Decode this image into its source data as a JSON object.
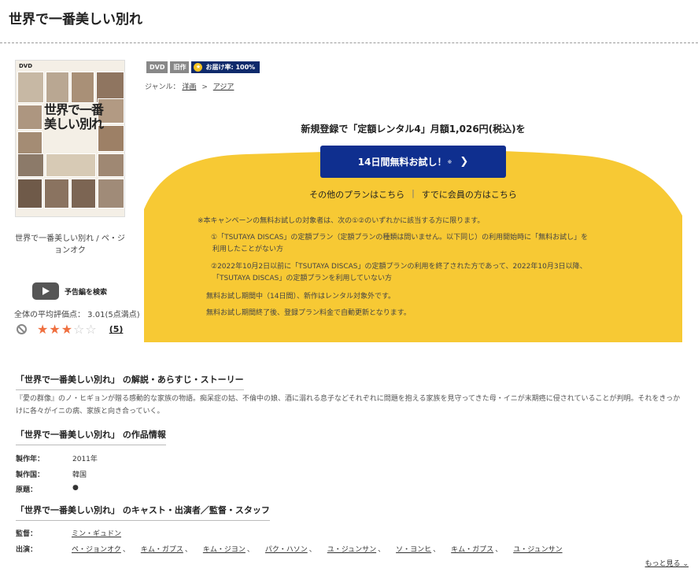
{
  "title": "世界で一番美しい別れ",
  "cover": {
    "dvd_mark": "DVD",
    "title_text": "世界で一番\n美しい別れ"
  },
  "cover_caption": "世界で一番美しい別れ / ペ・ジョンオク",
  "trailer_label": "予告編を検索",
  "average": "全体の平均評価点：  3.01(5点満点)",
  "rating": {
    "stars": 3,
    "max": 5,
    "count": "(5)"
  },
  "badges": {
    "dvd": "DVD",
    "old": "旧作",
    "delivery": "お届け率: 100%"
  },
  "genre": {
    "label": "ジャンル：",
    "level1": "洋画",
    "sep": ">",
    "level2": "アジア"
  },
  "campaign": {
    "headline": "新規登録で「定額レンタル4」月額1,026円(税込)を",
    "trial_button": "14日間無料お試し！",
    "trial_note_mark": "※",
    "other_plans": "その他のプランはこちら",
    "member_link": "すでに会員の方はこちら",
    "notes": [
      "※本キャンペーンの無料お試しの対象者は、次の①②のいずれかに該当する方に限ります。",
      "①「TSUTAYA DISCAS」の定額プラン（定額プランの種類は問いません。以下同じ）の利用開始時に「無料お試し」を",
      "利用したことがない方",
      "②2022年10月2日以前に「TSUTAYA DISCAS」の定額プランの利用を終了された方であって、2022年10月3日以降、",
      "「TSUTAYA DISCAS」の定額プランを利用していない方",
      "無料お試し期間中（14日間）、新作はレンタル対象外です。",
      "無料お試し期間終了後、登録プラン料金で自動更新となります。"
    ],
    "colors": {
      "bg": "#f7c934",
      "button": "#0f2f8f"
    }
  },
  "synopsis_title": "「世界で一番美しい別れ」 の解説・あらすじ・ストーリー",
  "synopsis": "『愛の群像』のノ・ヒギョンが贈る感動的な家族の物語。痴呆症の姑、不倫中の娘、酒に溺れる息子などそれぞれに問題を抱える家族を見守ってきた母・イニが末期癌に侵されていることが判明。それをきっかけに各々がイニの病、家族と向き合っていく。",
  "info_title": "「世界で一番美しい別れ」 の作品情報",
  "info": [
    {
      "key": "製作年：",
      "value": "2011年"
    },
    {
      "key": "製作国：",
      "value": "韓国"
    },
    {
      "key": "原題：",
      "value": "●"
    }
  ],
  "cast_title": "「世界で一番美しい別れ」 のキャスト・出演者／監督・スタッフ",
  "director": {
    "key": "監督：",
    "names": [
      "ミン・ギュドン"
    ]
  },
  "cast": {
    "key": "出演：",
    "names": [
      "ペ・ジョンオク",
      "キム・ガプス",
      "キム・ジヨン",
      "パク・ハソン",
      "ユ・ジュンサン",
      "ソ・ヨンヒ",
      "キム・ガプス",
      "ユ・ジュンサン"
    ]
  },
  "more": "もっと見る"
}
